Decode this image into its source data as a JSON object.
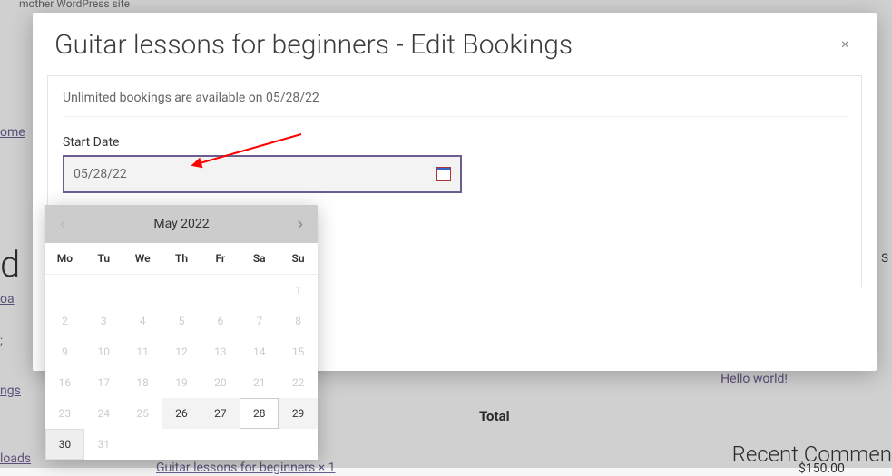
{
  "background": {
    "tag": "mother WordPress site",
    "nav0": "ome",
    "nav1": "oa",
    "nav2": ";",
    "nav3": "ngs",
    "nav4": "loads",
    "bigD": "d",
    "hello": "Hello world!",
    "total": "Total",
    "price": "$150.00",
    "cart": "Guitar lessons for beginners × 1",
    "rc": "Recent Commen",
    "S": "S"
  },
  "modal": {
    "title": "Guitar lessons for beginners - Edit Bookings",
    "close": "×",
    "availability": "Unlimited bookings are available on 05/28/22",
    "start_label": "Start Date",
    "start_value": "05/28/22"
  },
  "calendar": {
    "month": "May 2022",
    "prev": "‹",
    "next": "›",
    "days": [
      "Mo",
      "Tu",
      "We",
      "Th",
      "Fr",
      "Sa",
      "Su"
    ],
    "cells": [
      {
        "n": "",
        "cls": "emp"
      },
      {
        "n": "",
        "cls": "emp"
      },
      {
        "n": "",
        "cls": "emp"
      },
      {
        "n": "",
        "cls": "emp"
      },
      {
        "n": "",
        "cls": "emp"
      },
      {
        "n": "",
        "cls": "emp"
      },
      {
        "n": "1",
        "cls": "disabled"
      },
      {
        "n": "2",
        "cls": "disabled"
      },
      {
        "n": "3",
        "cls": "disabled"
      },
      {
        "n": "4",
        "cls": "disabled"
      },
      {
        "n": "5",
        "cls": "disabled"
      },
      {
        "n": "6",
        "cls": "disabled"
      },
      {
        "n": "7",
        "cls": "disabled"
      },
      {
        "n": "8",
        "cls": "disabled"
      },
      {
        "n": "9",
        "cls": "disabled"
      },
      {
        "n": "10",
        "cls": "disabled"
      },
      {
        "n": "11",
        "cls": "disabled"
      },
      {
        "n": "12",
        "cls": "disabled"
      },
      {
        "n": "13",
        "cls": "disabled"
      },
      {
        "n": "14",
        "cls": "disabled"
      },
      {
        "n": "15",
        "cls": "disabled"
      },
      {
        "n": "16",
        "cls": "disabled"
      },
      {
        "n": "17",
        "cls": "disabled"
      },
      {
        "n": "18",
        "cls": "disabled"
      },
      {
        "n": "19",
        "cls": "disabled"
      },
      {
        "n": "20",
        "cls": "disabled"
      },
      {
        "n": "21",
        "cls": "disabled"
      },
      {
        "n": "22",
        "cls": "disabled"
      },
      {
        "n": "23",
        "cls": "disabled"
      },
      {
        "n": "24",
        "cls": "disabled"
      },
      {
        "n": "25",
        "cls": "disabled"
      },
      {
        "n": "26",
        "cls": "avail"
      },
      {
        "n": "27",
        "cls": "avail"
      },
      {
        "n": "28",
        "cls": "sel"
      },
      {
        "n": "29",
        "cls": "avail"
      },
      {
        "n": "30",
        "cls": "today"
      },
      {
        "n": "31",
        "cls": "disabled"
      },
      {
        "n": "",
        "cls": "emp"
      },
      {
        "n": "",
        "cls": "emp"
      },
      {
        "n": "",
        "cls": "emp"
      },
      {
        "n": "",
        "cls": "emp"
      },
      {
        "n": "",
        "cls": "emp"
      }
    ]
  }
}
